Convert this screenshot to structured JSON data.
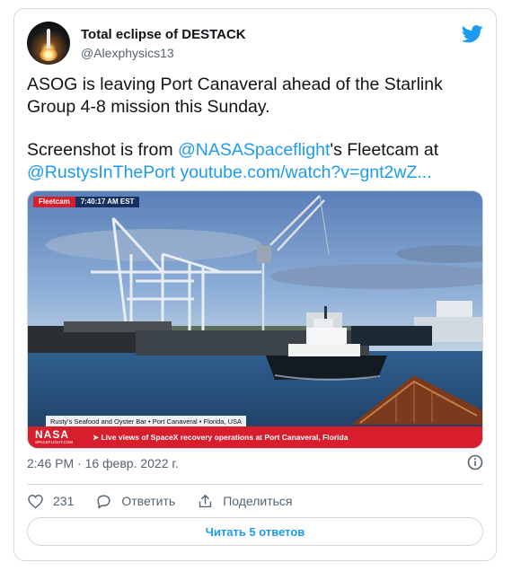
{
  "author": {
    "name": "Total eclipse of DESTACK",
    "handle": "@Alexphysics13",
    "avatar": "rocket-launch-avatar"
  },
  "tweet": {
    "paragraph1": "ASOG is leaving Port Canaveral ahead of the Starlink Group 4-8 mission this Sunday.",
    "p2_prefix": "Screenshot is from ",
    "p2_mention1": "@NASASpaceflight",
    "p2_middle": "'s Fleetcam at",
    "p2_mention2": "@RustysInThePort",
    "p2_space": " ",
    "p2_link": "youtube.com/watch?v=gnt2wZ..."
  },
  "media": {
    "fleetcam_label": "Fleetcam",
    "time_label": "7:40:17 AM EST",
    "location_label": "Rusty's Seafood and Oyster Bar  •  Port Canaveral  •  Florida, USA",
    "nasa_logo": "NASA",
    "nasa_sub": "SPACEFLIGHT.COM",
    "caption": "➤ Live views of SpaceX recovery operations at Port Canaveral, Florida"
  },
  "meta": {
    "timestamp": "2:46 PM · 16 февр. 2022 г."
  },
  "actions": {
    "likes": "231",
    "reply_label": "Ответить",
    "share_label": "Поделиться"
  },
  "replies_button": "Читать 5 ответов",
  "colors": {
    "accent": "#1d9bf0",
    "text": "#0f1419",
    "secondary": "#536471",
    "border": "#cfd9de",
    "nasa_red": "#d81e2c"
  },
  "icons": {
    "brand": "twitter-bird-icon",
    "info": "info-icon",
    "like": "heart-icon",
    "reply": "reply-bubble-icon",
    "share": "share-icon"
  }
}
